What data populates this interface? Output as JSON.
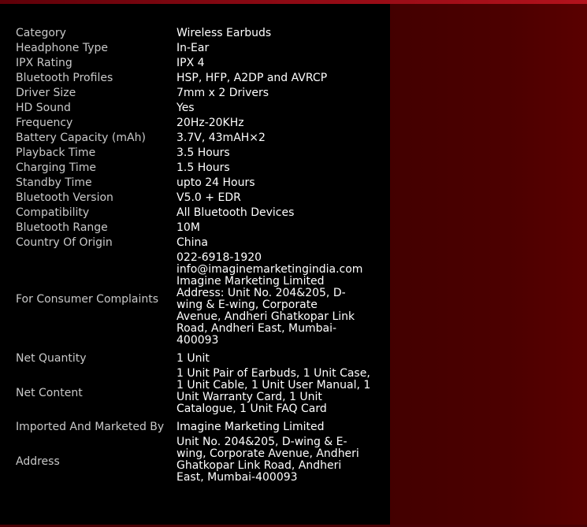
{
  "specs": [
    {
      "label": "Category",
      "value": "Wireless Earbuds"
    },
    {
      "label": "Headphone Type",
      "value": "In-Ear"
    },
    {
      "label": "IPX Rating",
      "value": "IPX 4"
    },
    {
      "label": "Bluetooth Profiles",
      "value": "HSP, HFP, A2DP and AVRCP"
    },
    {
      "label": "Driver Size",
      "value": "7mm x 2 Drivers"
    },
    {
      "label": "HD Sound",
      "value": "Yes"
    },
    {
      "label": "Frequency",
      "value": "20Hz-20KHz"
    },
    {
      "label": "Battery Capacity (mAh)",
      "value": "3.7V, 43mAH×2"
    },
    {
      "label": "Playback Time",
      "value": "3.5 Hours"
    },
    {
      "label": "Charging Time",
      "value": "1.5 Hours"
    },
    {
      "label": "Standby Time",
      "value": "upto 24 Hours"
    },
    {
      "label": "Bluetooth Version",
      "value": "V5.0 + EDR"
    },
    {
      "label": "Compatibility",
      "value": "All Bluetooth Devices"
    },
    {
      "label": "Bluetooth Range",
      "value": "10M"
    },
    {
      "label": "Country Of Origin",
      "value": "China"
    },
    {
      "label": "For Consumer Complaints",
      "value": "022-6918-1920\ninfo@imaginemarketingindia.com\nImagine Marketing Limited\nAddress: Unit No. 204&205, D-\nwing & E-wing, Corporate\nAvenue, Andheri Ghatkopar Link\nRoad, Andheri East, Mumbai-\n400093"
    },
    {
      "label": "Net Quantity",
      "value": "1 Unit"
    },
    {
      "label": "Net Content",
      "value": "1 Unit Pair of Earbuds, 1 Unit Case,\n1 Unit Cable, 1 Unit User Manual, 1\nUnit Warranty Card, 1 Unit\nCatalogue, 1 Unit FAQ Card"
    },
    {
      "label": "Imported And Marketed By",
      "value": "Imagine Marketing Limited"
    },
    {
      "label": "Address",
      "value": "Unit No. 204&205, D-wing & E-\nwing, Corporate Avenue, Andheri\nGhatkopar Link Road, Andheri\nEast, Mumbai-400093"
    }
  ],
  "colors": {
    "panel_background": "#000000",
    "label_text": "#c9c9c9",
    "value_text": "#ffffff",
    "accent_red": "#8e0a14"
  }
}
